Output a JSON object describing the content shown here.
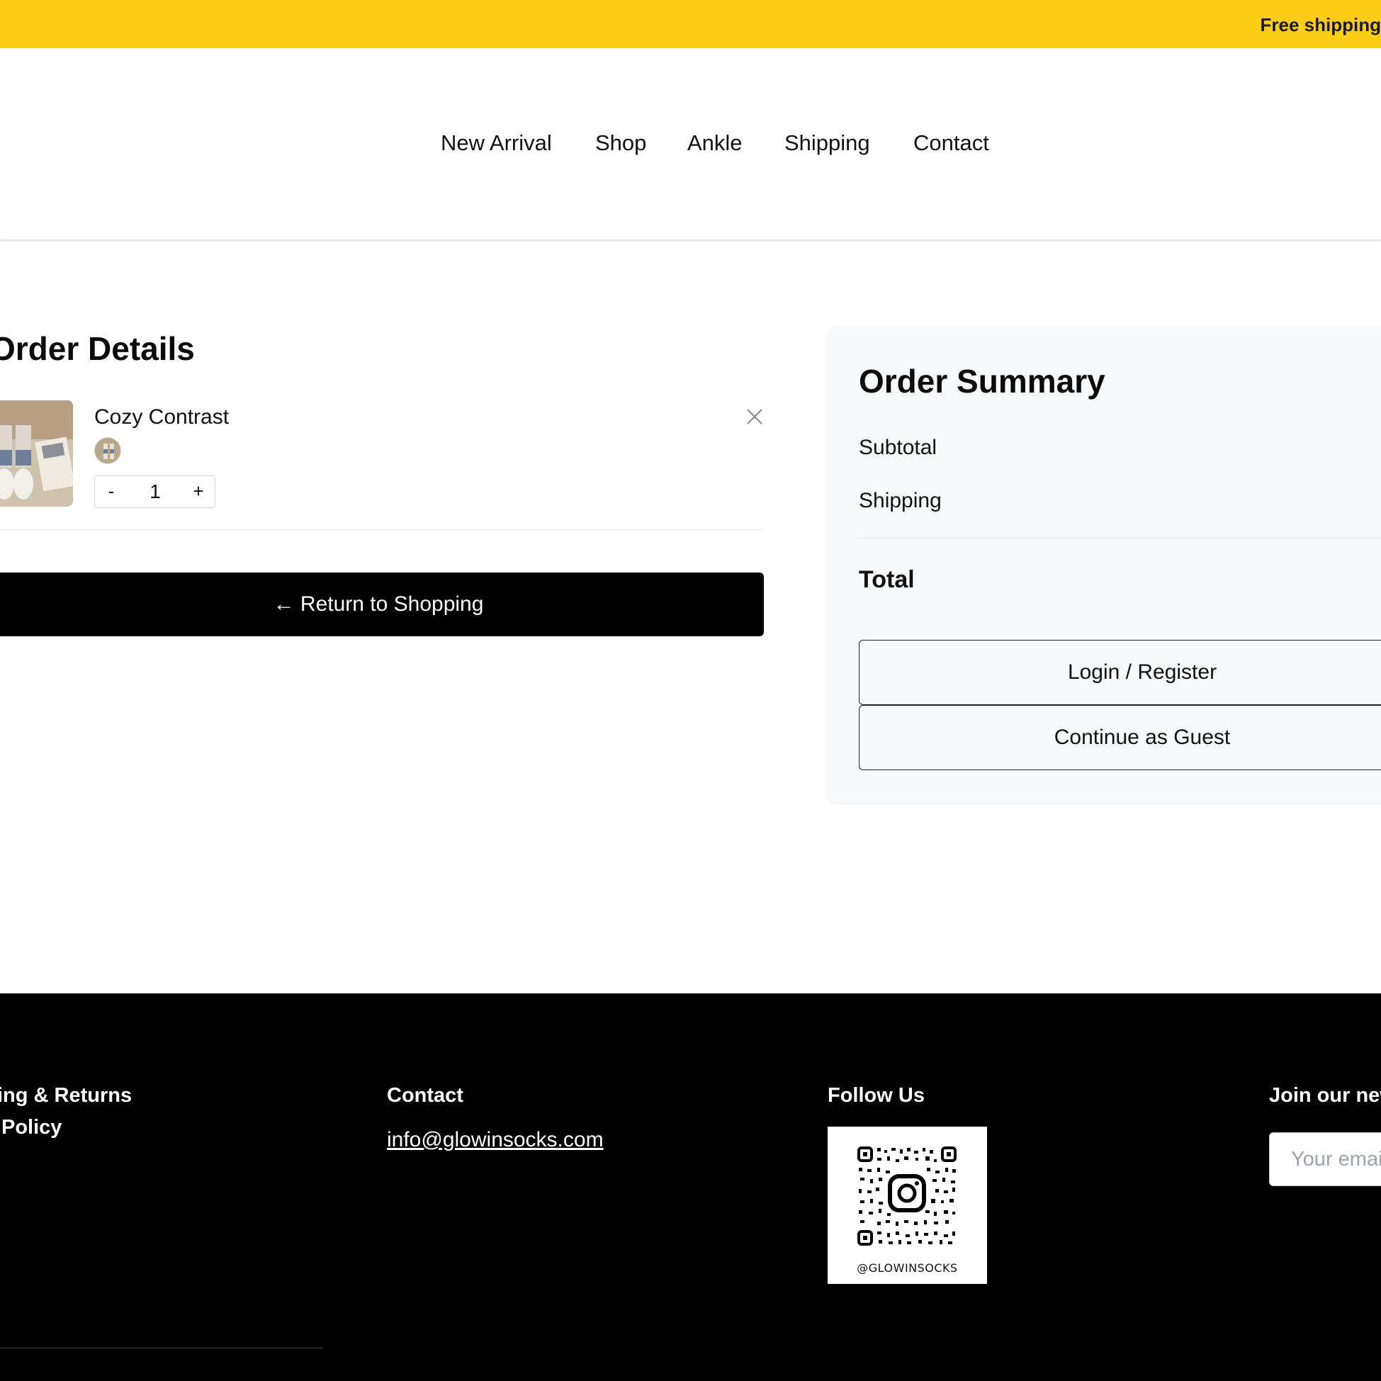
{
  "announcement": {
    "text": "Free shipping"
  },
  "nav": {
    "items": [
      {
        "label": "New Arrival"
      },
      {
        "label": "Shop"
      },
      {
        "label": "Ankle"
      },
      {
        "label": "Shipping"
      },
      {
        "label": "Contact"
      }
    ]
  },
  "order_details": {
    "title": "Order Details",
    "item": {
      "name": "Cozy Contrast",
      "quantity": "1",
      "minus_label": "-",
      "plus_label": "+"
    },
    "return_label": "← Return to Shopping"
  },
  "summary": {
    "title": "Order Summary",
    "subtotal_label": "Subtotal",
    "shipping_label": "Shipping",
    "total_label": "Total",
    "login_label": "Login / Register",
    "guest_label": "Continue as Guest"
  },
  "footer": {
    "links": [
      "ing & Returns",
      "Policy"
    ],
    "contact_heading": "Contact",
    "contact_email": "info@glowinsocks.com",
    "follow_heading": "Follow Us",
    "instagram_handle": "@GLOWINSOCKS",
    "newsletter_heading": "Join our new",
    "newsletter_placeholder": "Your emai"
  },
  "colors": {
    "announcement_bg": "#fbcd17",
    "button_dark": "#000000",
    "summary_bg": "#f8f9fa",
    "footer_bg": "#000000"
  }
}
